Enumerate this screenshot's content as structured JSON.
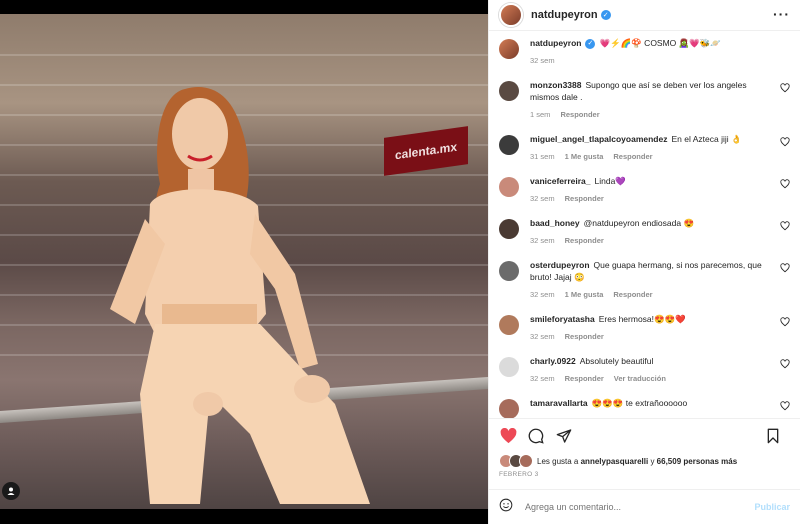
{
  "media": {
    "photo_alt": "",
    "banner_text": "calenta.mx"
  },
  "header": {
    "username": "natdupeyron",
    "more_icon": "more-horizontal-icon"
  },
  "caption": {
    "username": "natdupeyron",
    "text": "💗⚡🌈🍄 COSMO 🧟‍♀️💗🐝🪐",
    "time": "32 sem"
  },
  "comments": [
    {
      "user": "monzon3388",
      "text": "Supongo que así se deben ver los angeles mismos dale .",
      "time": "1 sem",
      "likes": "",
      "reply": "Responder",
      "translate": "",
      "avatar_color": "#5a4a42"
    },
    {
      "user": "miguel_angel_tlapalcoyoamendez",
      "text": "En el Azteca jiji 👌",
      "time": "31 sem",
      "likes": "1 Me gusta",
      "reply": "Responder",
      "translate": "",
      "avatar_color": "#3b3b3b"
    },
    {
      "user": "vaniceferreira_",
      "text": "Linda💜",
      "time": "32 sem",
      "likes": "",
      "reply": "Responder",
      "translate": "",
      "avatar_color": "#c98a7a"
    },
    {
      "user": "baad_honey",
      "text": "@natdupeyron endiosada 😍",
      "time": "32 sem",
      "likes": "",
      "reply": "Responder",
      "translate": "",
      "avatar_color": "#4a3a33"
    },
    {
      "user": "osterdupeyron",
      "text": "Que guapa hermang, si nos parecemos, que bruto! Jajaj 😳",
      "time": "32 sem",
      "likes": "1 Me gusta",
      "reply": "Responder",
      "translate": "",
      "avatar_color": "#6b6b6b"
    },
    {
      "user": "smileforyatasha",
      "text": "Eres hermosa!😍😍❤️",
      "time": "32 sem",
      "likes": "",
      "reply": "Responder",
      "translate": "",
      "avatar_color": "#b07a5c"
    },
    {
      "user": "charly.0922",
      "text": "Absolutely beautiful",
      "time": "32 sem",
      "likes": "",
      "reply": "Responder",
      "translate": "Ver traducción",
      "avatar_color": "#dbdbdb"
    },
    {
      "user": "tamaravallarta",
      "text": "😍😍😍 te extrañoooooo",
      "time": "",
      "likes": "",
      "reply": "",
      "translate": "",
      "avatar_color": "#a66b5b"
    }
  ],
  "likes": {
    "prefix": "Les gusta a",
    "user": "annelypasquarelli",
    "connector": "y",
    "count": "66,509 personas más"
  },
  "date": "FEBRERO 3",
  "comment_box": {
    "placeholder": "Agrega un comentario...",
    "post_label": "Publicar"
  },
  "colors": {
    "like_red": "#ed4956",
    "verified_blue": "#3897f0",
    "link_blue": "#b2dffc"
  }
}
